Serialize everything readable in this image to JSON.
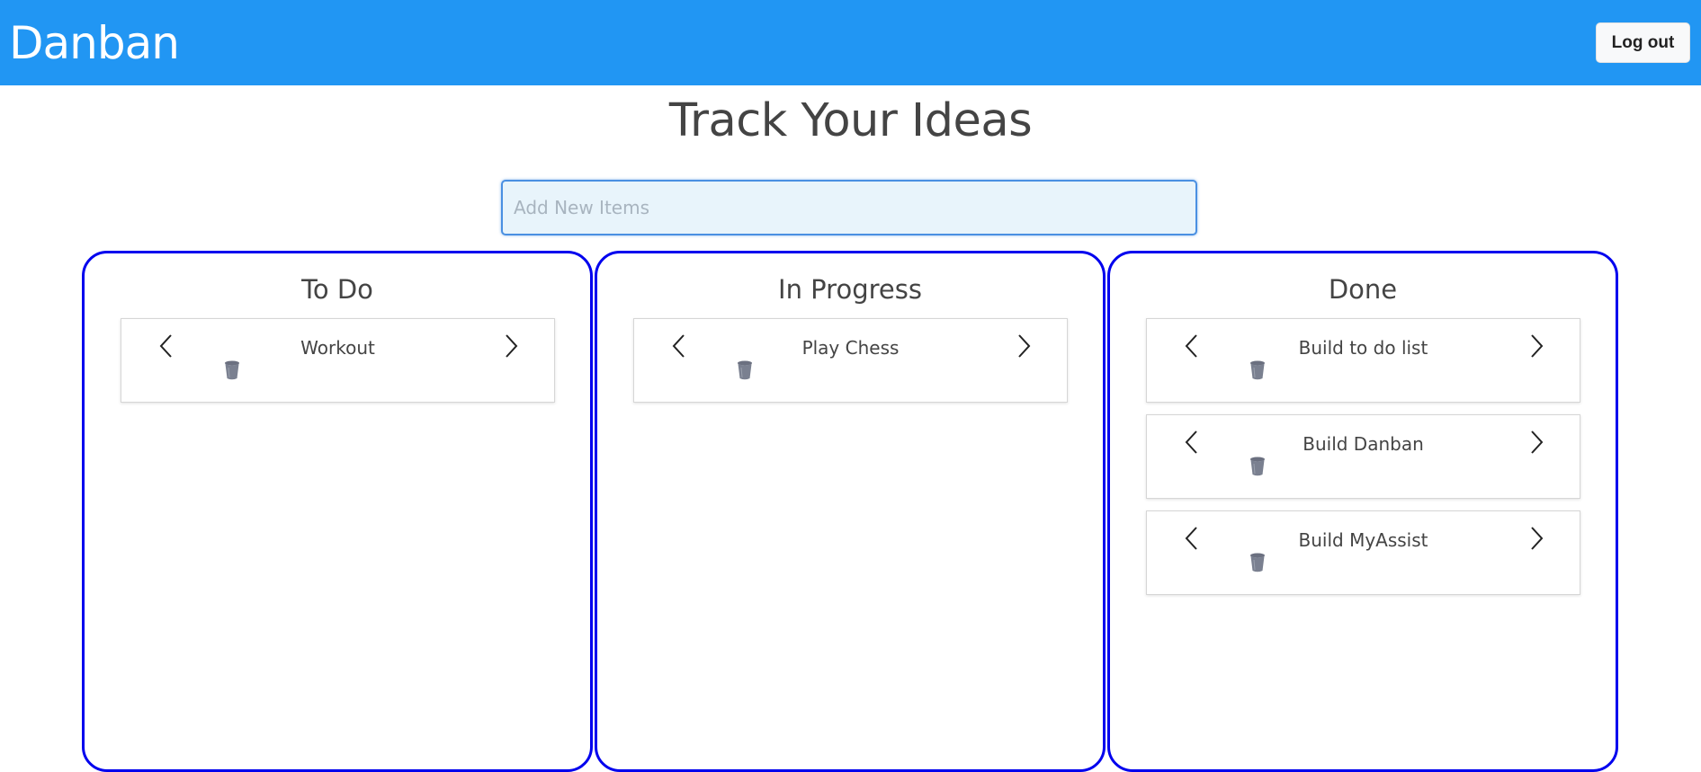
{
  "header": {
    "brand": "Danban",
    "logout_label": "Log out",
    "background_color": "#2196f3"
  },
  "main": {
    "title": "Track Your Ideas",
    "new_item_input": {
      "placeholder": "Add New Items",
      "value": ""
    }
  },
  "columns": [
    {
      "title": "To Do",
      "items": [
        {
          "label": "Workout"
        }
      ]
    },
    {
      "title": "In Progress",
      "items": [
        {
          "label": "Play Chess"
        }
      ]
    },
    {
      "title": "Done",
      "items": [
        {
          "label": "Build to do list"
        },
        {
          "label": "Build Danban"
        },
        {
          "label": "Build MyAssist"
        }
      ]
    }
  ],
  "icons": {
    "prev": "chevron-left-icon",
    "next": "chevron-right-icon",
    "delete": "trash-icon"
  },
  "colors": {
    "column_border": "#0000ee",
    "input_background": "#e8f4fb",
    "trash_icon": "#6b7080"
  }
}
